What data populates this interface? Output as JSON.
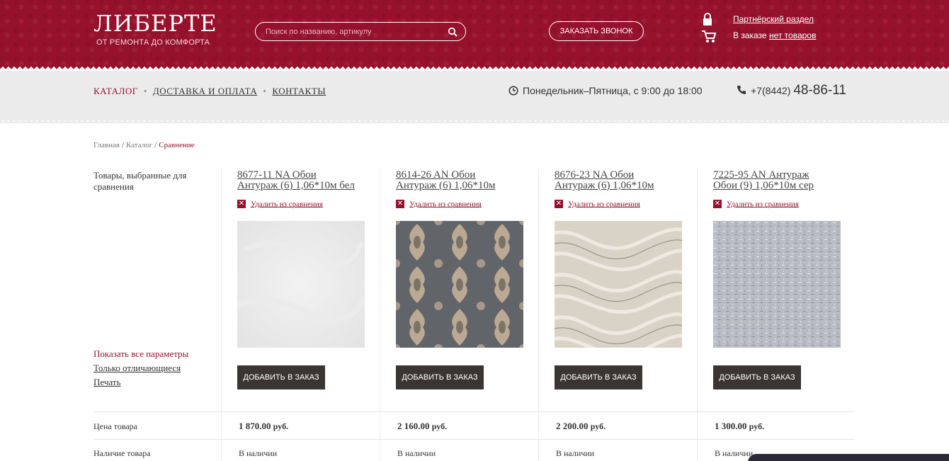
{
  "header": {
    "logo_title": "ЛИБЕРТЕ",
    "logo_subtitle": "ОТ РЕМОНТА ДО КОМФОРТА",
    "search_placeholder": "Поиск по названию, артикулу",
    "callback_label": "ЗАКАЗАТЬ ЗВОНОК",
    "partner_link": "Партнёрский раздел",
    "order_prefix": "В заказе",
    "order_link": "нет товаров",
    "brand_color": "#96112c"
  },
  "nav": {
    "items": [
      {
        "label": "КАТАЛОГ",
        "active": true
      },
      {
        "label": "ДОСТАВКА И ОПЛАТА",
        "active": false
      },
      {
        "label": "КОНТАКТЫ",
        "active": false
      }
    ],
    "hours": "Понедельник–Пятница, с 9:00 до 18:00",
    "phone_prefix": "+7(8442)",
    "phone_number": "48-86-11"
  },
  "breadcrumb": {
    "items": [
      "Главная",
      "Каталог",
      "Сравнение"
    ]
  },
  "compare": {
    "left_title": "Товары, выбранные для сравнения",
    "show_all": "Показать все параметры",
    "only_diff": "Только отличающиеся",
    "print": "Печать",
    "remove_label": "Удалить из сравнения",
    "add_label": "ДОБАВИТЬ В ЗАКАЗ",
    "price_label": "Цена товара",
    "availability_label": "Наличие товара",
    "products": [
      {
        "title_line1": "8677-11 NA Обои",
        "title_line2": "Антураж (6) 1,06*10м бел",
        "price": "1 870.00",
        "currency": "руб.",
        "availability": "В наличии"
      },
      {
        "title_line1": "8614-26 AN Обои",
        "title_line2": "Антураж (6) 1,06*10м",
        "price": "2 160.00",
        "currency": "руб.",
        "availability": "В наличии"
      },
      {
        "title_line1": "8676-23 NA Обои",
        "title_line2": "Антураж (6) 1,06*10м",
        "price": "2 200.00",
        "currency": "руб.",
        "availability": "В наличии"
      },
      {
        "title_line1": "7225-95 AN Антураж",
        "title_line2": "Обои (9) 1,06*10м сер",
        "price": "1 300.00",
        "currency": "руб.",
        "availability": "В наличии"
      }
    ]
  }
}
